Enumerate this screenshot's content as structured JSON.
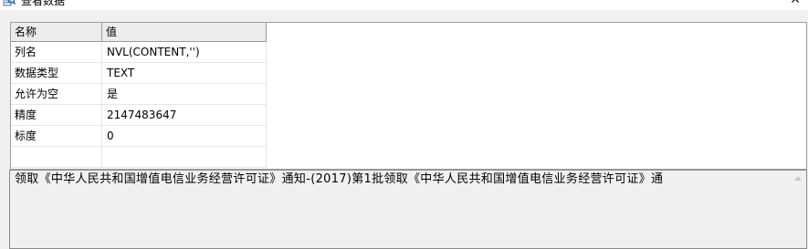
{
  "window": {
    "title": "查看数据",
    "close_glyph": "✕",
    "icon": "magnifier-data-icon"
  },
  "grid": {
    "columns": [
      "名称",
      "值"
    ],
    "rows": [
      {
        "name": "列名",
        "value": "NVL(CONTENT,'')"
      },
      {
        "name": "数据类型",
        "value": "TEXT"
      },
      {
        "name": "允许为空",
        "value": "是"
      },
      {
        "name": "精度",
        "value": "2147483647"
      },
      {
        "name": "标度",
        "value": "0"
      }
    ]
  },
  "detail": {
    "text": "领取《中华人民共和国增值电信业务经营许可证》通知-(2017)第1批领取《中华人民共和国增值电信业务经营许可证》通"
  }
}
